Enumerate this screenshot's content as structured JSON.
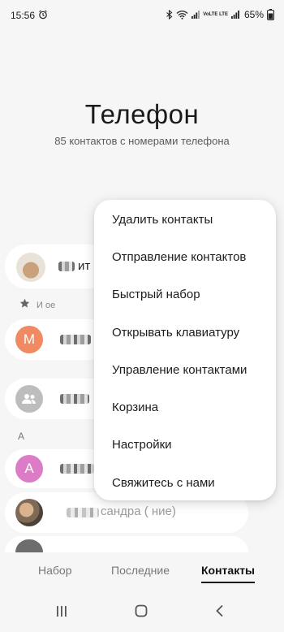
{
  "status_bar": {
    "time": "15:56",
    "battery": "65%",
    "network_label": "VoLTE LTE",
    "icons": [
      "alarm-icon",
      "bluetooth-icon",
      "wifi-icon",
      "signal-icon",
      "battery-icon"
    ]
  },
  "header": {
    "title": "Телефон",
    "subtitle": "85 контактов с номерами телефона"
  },
  "contacts": {
    "favorites_label_partial": "И  ое",
    "section_letter": "А",
    "avatar_letters": [
      "М",
      "А"
    ],
    "partial_names": [
      "ит",
      "сандра (  ние)"
    ]
  },
  "menu": {
    "items": [
      "Удалить контакты",
      "Отправление контактов",
      "Быстрый набор",
      "Открывать клавиатуру",
      "Управление контактами",
      "Корзина",
      "Настройки",
      "Свяжитесь с нами"
    ]
  },
  "tabs": {
    "items": [
      "Набор",
      "Последние",
      "Контакты"
    ],
    "active": "Контакты"
  },
  "colors": {
    "avatar_m": "#ef8a63",
    "avatar_a": "#dc7bc6",
    "avatar_group": "#bdbdbd",
    "background": "#f6f6f6"
  }
}
